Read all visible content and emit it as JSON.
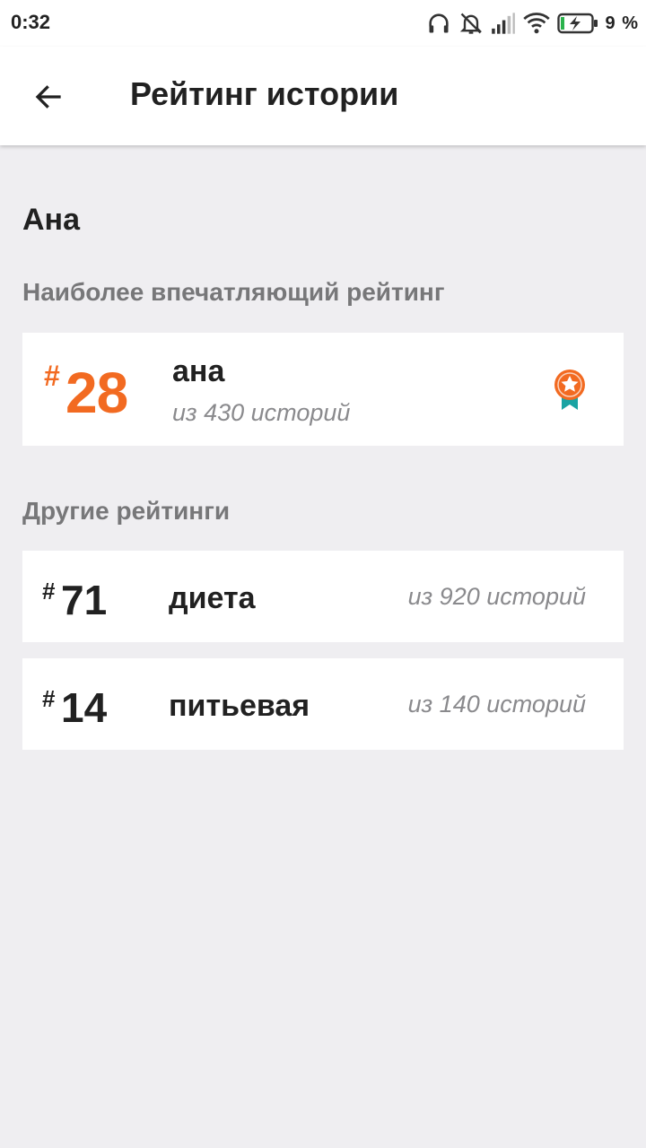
{
  "status_bar": {
    "time": "0:32",
    "battery_percent": "9 %"
  },
  "app_bar": {
    "title": "Рейтинг истории"
  },
  "story": {
    "name": "Ана"
  },
  "top_ranking": {
    "section_title": "Наиболее впечатляющий рейтинг",
    "hash": "#",
    "rank": "28",
    "tag": "ана",
    "subtitle": "из 430 историй",
    "accent_color": "#f26a21",
    "icon": "medal-icon"
  },
  "other_rankings": {
    "section_title": "Другие рейтинги",
    "items": [
      {
        "hash": "#",
        "rank": "71",
        "tag": "диета",
        "subtitle": "из 920 историй"
      },
      {
        "hash": "#",
        "rank": "14",
        "tag": "питьевая",
        "subtitle": "из 140 историй"
      }
    ]
  }
}
